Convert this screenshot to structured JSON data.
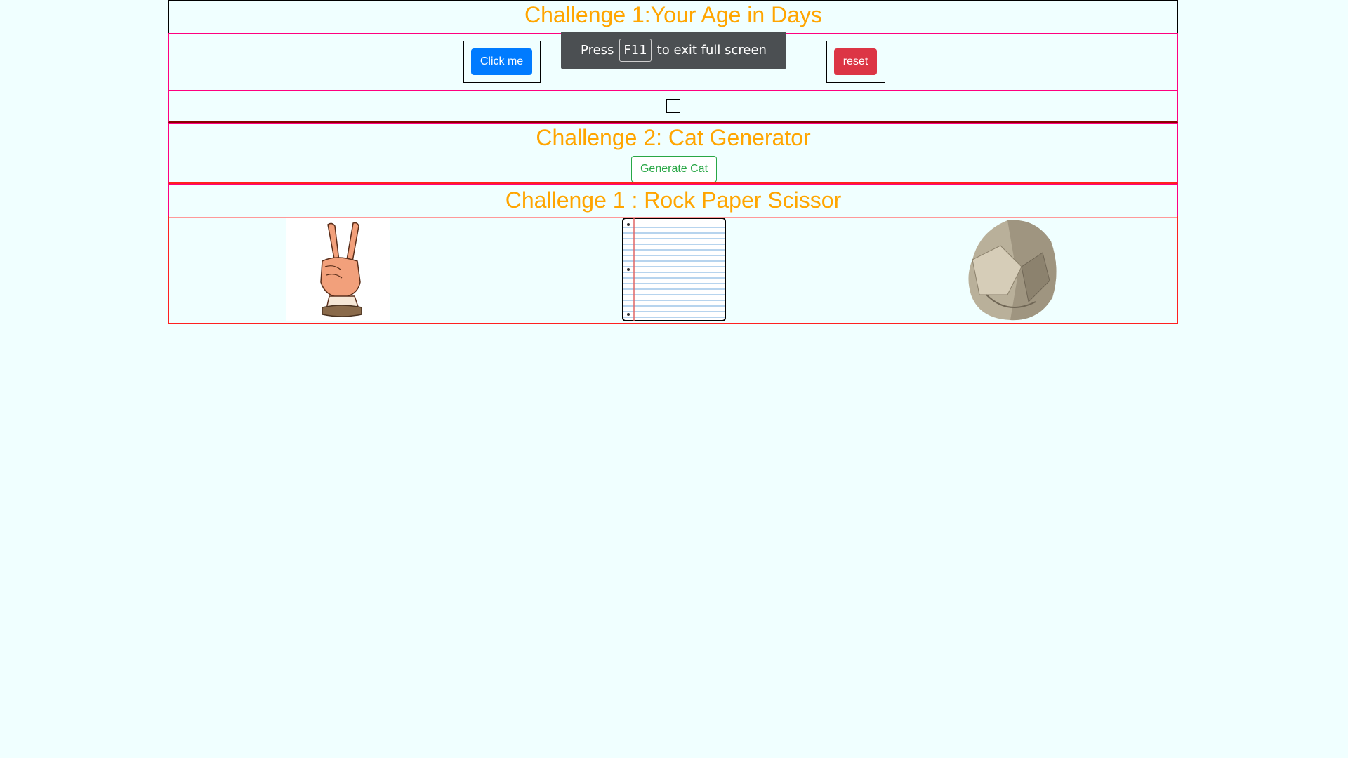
{
  "challenge1": {
    "title": "Challenge 1:Your Age in Days",
    "click_label": "Click me",
    "reset_label": "reset"
  },
  "challenge2": {
    "title": "Challenge 2: Cat Generator",
    "generate_label": "Generate Cat"
  },
  "challenge3": {
    "title": "Challenge 1 : Rock Paper Scissor",
    "images": [
      "scissors-hand-image",
      "paper-image",
      "rock-image"
    ]
  },
  "fullscreen_toast": {
    "prefix": "Press",
    "key": "F11",
    "suffix": "to exit full screen"
  },
  "colors": {
    "background": "#f0ffff",
    "title": "#ffa500",
    "primary": "#007bff",
    "danger": "#dc3545",
    "success": "#28a745"
  }
}
